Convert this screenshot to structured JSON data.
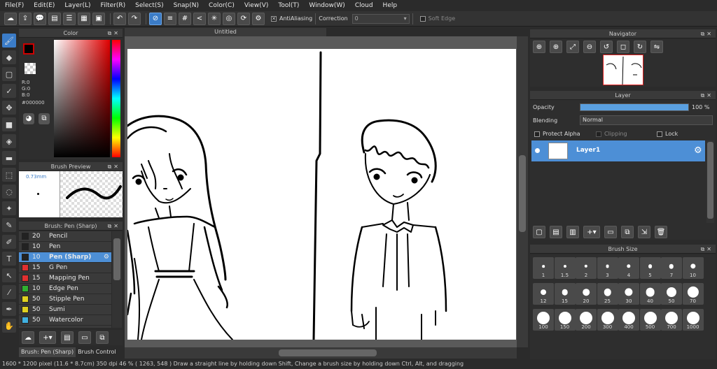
{
  "menu": [
    "File(F)",
    "Edit(E)",
    "Layer(L)",
    "Filter(R)",
    "Select(S)",
    "Snap(N)",
    "Color(C)",
    "View(V)",
    "Tool(T)",
    "Window(W)",
    "Cloud",
    "Help"
  ],
  "toolbar": {
    "antialiasing_label": "AntiAliasing",
    "correction_label": "Correction",
    "correction_value": "0",
    "soft_edge_label": "Soft Edge"
  },
  "color_panel": {
    "title": "Color",
    "r": "R:0",
    "g": "G:0",
    "b": "B:0",
    "hex": "#000000"
  },
  "brush_preview": {
    "title": "Brush Preview",
    "size": "0.73mm"
  },
  "brush_panel": {
    "title": "Brush: Pen (Sharp)",
    "items": [
      {
        "size": "20",
        "name": "Pencil",
        "color": "#222222"
      },
      {
        "size": "10",
        "name": "Pen",
        "color": "#222222"
      },
      {
        "size": "10",
        "name": "Pen (Sharp)",
        "color": "#222222",
        "selected": true
      },
      {
        "size": "15",
        "name": "G Pen",
        "color": "#e03030"
      },
      {
        "size": "15",
        "name": "Mapping Pen",
        "color": "#e03030"
      },
      {
        "size": "10",
        "name": "Edge Pen",
        "color": "#30b030"
      },
      {
        "size": "50",
        "name": "Stipple Pen",
        "color": "#e0d020"
      },
      {
        "size": "50",
        "name": "Sumi",
        "color": "#e0d020"
      },
      {
        "size": "50",
        "name": "Watercolor",
        "color": "#40b0e0"
      }
    ],
    "tab1": "Brush: Pen (Sharp)",
    "tab2": "Brush Control"
  },
  "canvas_tab": "Untitled",
  "navigator": {
    "title": "Navigator"
  },
  "layer_panel": {
    "title": "Layer",
    "opacity_label": "Opacity",
    "opacity_value": "100 %",
    "opacity_fraction": 1.0,
    "blending_label": "Blending",
    "blending_value": "Normal",
    "protect_alpha": "Protect Alpha",
    "clipping": "Clipping",
    "lock": "Lock",
    "layer_name": "Layer1"
  },
  "brush_size": {
    "title": "Brush Size",
    "sizes": [
      "1",
      "1.5",
      "2",
      "3",
      "4",
      "5",
      "7",
      "10",
      "12",
      "15",
      "20",
      "25",
      "30",
      "40",
      "50",
      "70",
      "100",
      "150",
      "200",
      "300",
      "400",
      "500",
      "700",
      "1000"
    ]
  },
  "status": {
    "text": "1600 * 1200 pixel   (11.6 * 8.7cm)   350 dpi   46 %   ( 1263, 548 )   Draw a straight line by holding down Shift, Change a brush size by holding down Ctrl, Alt, and dragging"
  }
}
